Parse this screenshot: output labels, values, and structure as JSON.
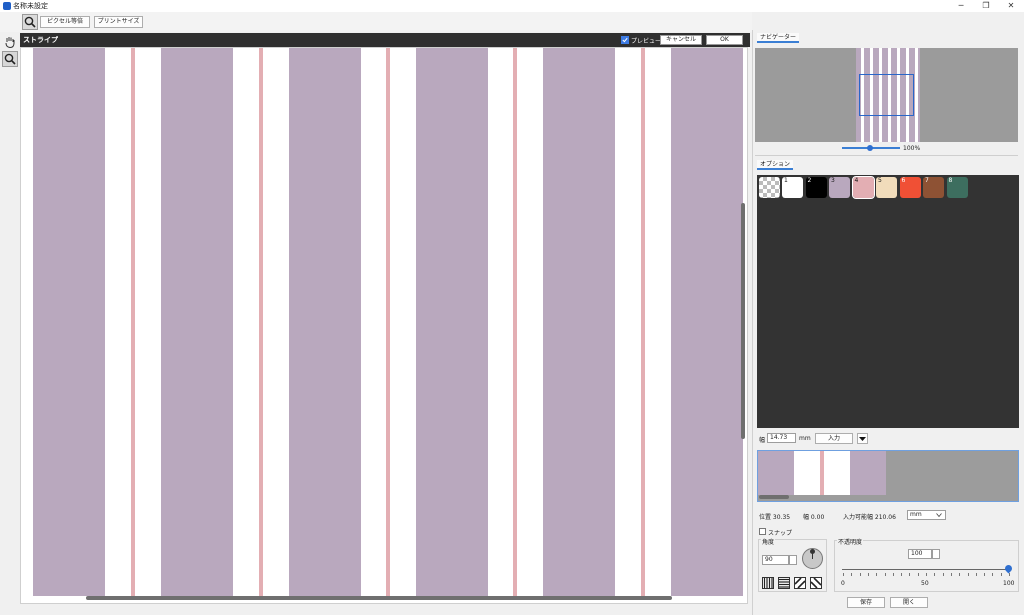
{
  "window": {
    "title": "名称未設定",
    "min": "─",
    "max": "❐",
    "close": "✕"
  },
  "toolbar": {
    "pixel_equal": "ピクセル等倍",
    "print_size": "プリントサイズ"
  },
  "editor": {
    "title": "ストライプ",
    "preview_label": "プレビュー",
    "cancel": "キャンセル",
    "ok": "OK",
    "colors": {
      "purple": "#b9a8be",
      "white": "#ffffff",
      "pink": "#e3aeb3"
    }
  },
  "right": {
    "navigator_tab": "ナビゲーター",
    "zoom": "100%",
    "options_tab": "オプション",
    "swatches": [
      {
        "num": "1",
        "color": "#ffffff"
      },
      {
        "num": "2",
        "color": "#000000"
      },
      {
        "num": "3",
        "color": "#b9a8be"
      },
      {
        "num": "4",
        "color": "#e3aeb3"
      },
      {
        "num": "5",
        "color": "#f1dcbb"
      },
      {
        "num": "6",
        "color": "#f05035"
      },
      {
        "num": "7",
        "color": "#8e5234"
      },
      {
        "num": "8",
        "color": "#3d6e5f"
      }
    ],
    "width_label": "幅",
    "width_value": "14.73",
    "unit_mm": "mm",
    "input_button": "入力",
    "position_label": "位置 30.35",
    "width_small": "幅 0.00",
    "input_width": "入力可能幅 210.06",
    "unit_select": "mm",
    "snap_label": "スナップ",
    "angle_label": "角度",
    "angle_value": "90",
    "opacity_label": "不透明度",
    "opacity_value": "100",
    "opacity_min": "0",
    "opacity_mid": "50",
    "opacity_max": "100",
    "save_button": "保存",
    "open_button": "開く"
  }
}
